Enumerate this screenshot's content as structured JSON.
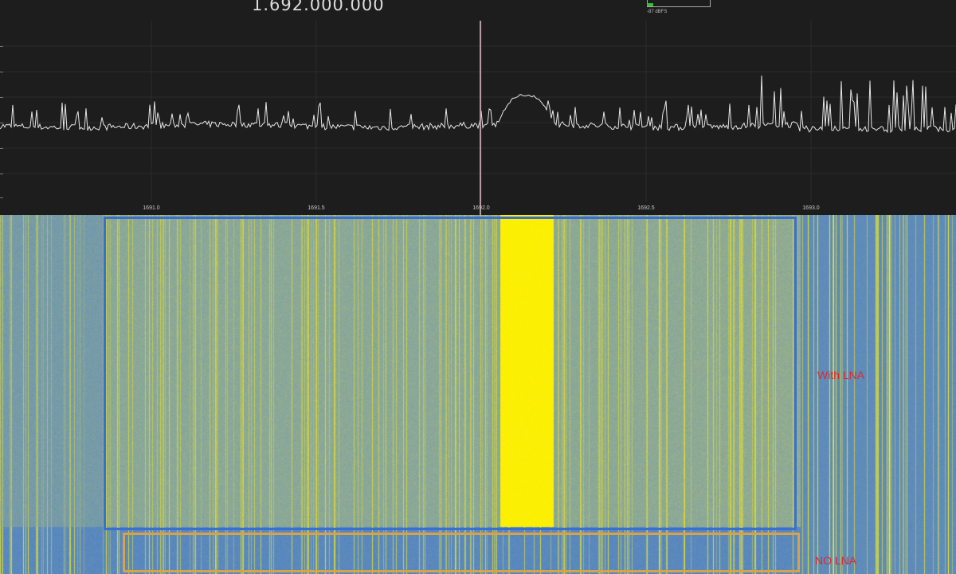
{
  "header": {
    "frequency_readout": "1.692.000.000",
    "level_label": "-87 dBFS"
  },
  "spectrum": {
    "center_freq_mhz": 1692.0,
    "freq_axis_labels": [
      "1691.0",
      "1691.5",
      "1692.0",
      "1692.5",
      "1693.0"
    ],
    "signal_hump_mhz": [
      1692.07,
      1692.21
    ]
  },
  "waterfall": {
    "regions": [
      {
        "label": "With LNA",
        "border_color": "#3a6fd0"
      },
      {
        "label": "NO LNA",
        "border_color": "#d9a24a"
      }
    ]
  },
  "colors": {
    "background": "#1e1d1e",
    "trace": "#e6e6e6",
    "cursor": "#b59aa0",
    "waterfall_low": "#3b74d6",
    "waterfall_mid": "#8fa995",
    "waterfall_high": "#fff200",
    "label_red": "#e3262a"
  }
}
